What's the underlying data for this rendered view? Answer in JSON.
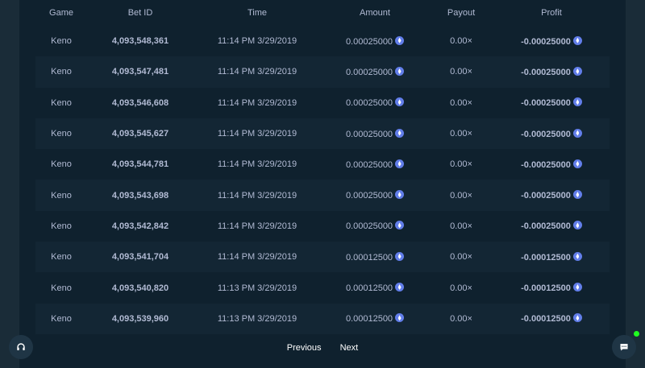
{
  "table": {
    "headers": [
      "Game",
      "Bet ID",
      "Time",
      "Amount",
      "Payout",
      "Profit"
    ],
    "currency_icon": "eth-icon",
    "rows": [
      {
        "game": "Keno",
        "bet_id": "4,093,548,361",
        "time": "11:14 PM 3/29/2019",
        "amount": "0.00025000",
        "payout": "0.00×",
        "profit": "-0.00025000"
      },
      {
        "game": "Keno",
        "bet_id": "4,093,547,481",
        "time": "11:14 PM 3/29/2019",
        "amount": "0.00025000",
        "payout": "0.00×",
        "profit": "-0.00025000"
      },
      {
        "game": "Keno",
        "bet_id": "4,093,546,608",
        "time": "11:14 PM 3/29/2019",
        "amount": "0.00025000",
        "payout": "0.00×",
        "profit": "-0.00025000"
      },
      {
        "game": "Keno",
        "bet_id": "4,093,545,627",
        "time": "11:14 PM 3/29/2019",
        "amount": "0.00025000",
        "payout": "0.00×",
        "profit": "-0.00025000"
      },
      {
        "game": "Keno",
        "bet_id": "4,093,544,781",
        "time": "11:14 PM 3/29/2019",
        "amount": "0.00025000",
        "payout": "0.00×",
        "profit": "-0.00025000"
      },
      {
        "game": "Keno",
        "bet_id": "4,093,543,698",
        "time": "11:14 PM 3/29/2019",
        "amount": "0.00025000",
        "payout": "0.00×",
        "profit": "-0.00025000"
      },
      {
        "game": "Keno",
        "bet_id": "4,093,542,842",
        "time": "11:14 PM 3/29/2019",
        "amount": "0.00025000",
        "payout": "0.00×",
        "profit": "-0.00025000"
      },
      {
        "game": "Keno",
        "bet_id": "4,093,541,704",
        "time": "11:14 PM 3/29/2019",
        "amount": "0.00012500",
        "payout": "0.00×",
        "profit": "-0.00012500"
      },
      {
        "game": "Keno",
        "bet_id": "4,093,540,820",
        "time": "11:13 PM 3/29/2019",
        "amount": "0.00012500",
        "payout": "0.00×",
        "profit": "-0.00012500"
      },
      {
        "game": "Keno",
        "bet_id": "4,093,539,960",
        "time": "11:13 PM 3/29/2019",
        "amount": "0.00012500",
        "payout": "0.00×",
        "profit": "-0.00012500"
      }
    ]
  },
  "pagination": {
    "previous_label": "Previous",
    "next_label": "Next"
  },
  "floating": {
    "support_icon": "headset-icon",
    "chat_icon": "chat-icon",
    "online_status_color": "#1fff20"
  },
  "colors": {
    "background": "#1a2c38",
    "panel": "#0f212e",
    "row_alt": "#132634",
    "muted_text": "#b1bad3",
    "eth_blue": "#627eea"
  }
}
